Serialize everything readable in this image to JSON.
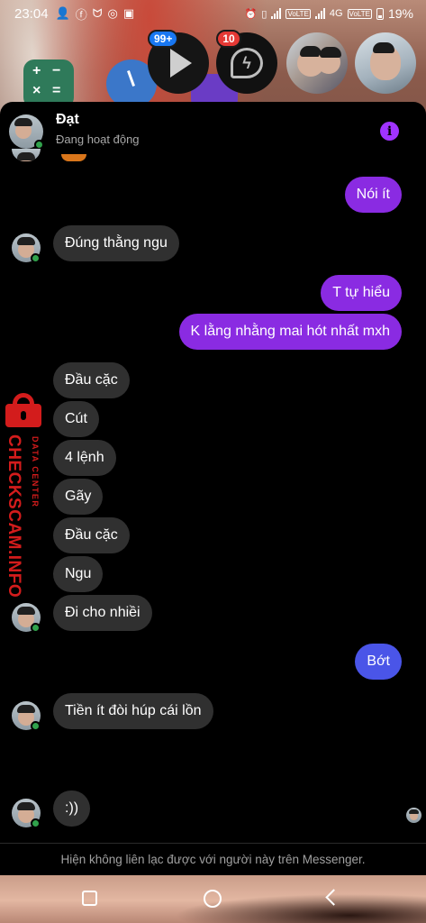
{
  "status_bar": {
    "time": "23:04",
    "battery_percent": "19%",
    "network_labels": [
      "VoLTE",
      "4G",
      "VoLTE"
    ]
  },
  "chat_heads": [
    {
      "name": "youtube",
      "badge": "99+",
      "badge_color": "#1877f2"
    },
    {
      "name": "messenger",
      "badge": "10",
      "badge_color": "#e53935"
    },
    {
      "name": "friends-photo",
      "badge": ""
    },
    {
      "name": "dat-photo",
      "badge": ""
    }
  ],
  "chat": {
    "contact_name": "Đạt",
    "contact_status": "Đang hoạt động",
    "info_icon": "i",
    "messages": [
      {
        "side": "out",
        "text": "Nói ít"
      },
      {
        "side": "in",
        "text": "Đúng thằng ngu"
      },
      {
        "side": "out",
        "text": "T tự hiểu"
      },
      {
        "side": "out",
        "text": "K lằng nhằng mai hót nhất mxh"
      },
      {
        "side": "in",
        "text": "Đầu cặc"
      },
      {
        "side": "in",
        "text": "Cút"
      },
      {
        "side": "in",
        "text": "4 lệnh"
      },
      {
        "side": "in",
        "text": "Gãy"
      },
      {
        "side": "in",
        "text": "Đầu cặc"
      },
      {
        "side": "in",
        "text": "Ngu"
      },
      {
        "side": "in",
        "text": "Đi cho nhiềi"
      },
      {
        "side": "out",
        "text": "Bớt"
      },
      {
        "side": "in",
        "text": "Tiền ít đòi húp cái lồn"
      },
      {
        "side": "in",
        "text": ":))"
      }
    ],
    "footer_notice": "Hiện không liên lạc được với người này trên Messenger."
  },
  "watermark": {
    "main": "CHECKSCAM.INFO",
    "sub": "DATA CENTER"
  },
  "colors": {
    "outgoing_purple": "#8a2be2",
    "outgoing_blue": "#4a55e8",
    "incoming": "#303030",
    "online": "#31a24c",
    "watermark_red": "#d31c1c"
  }
}
